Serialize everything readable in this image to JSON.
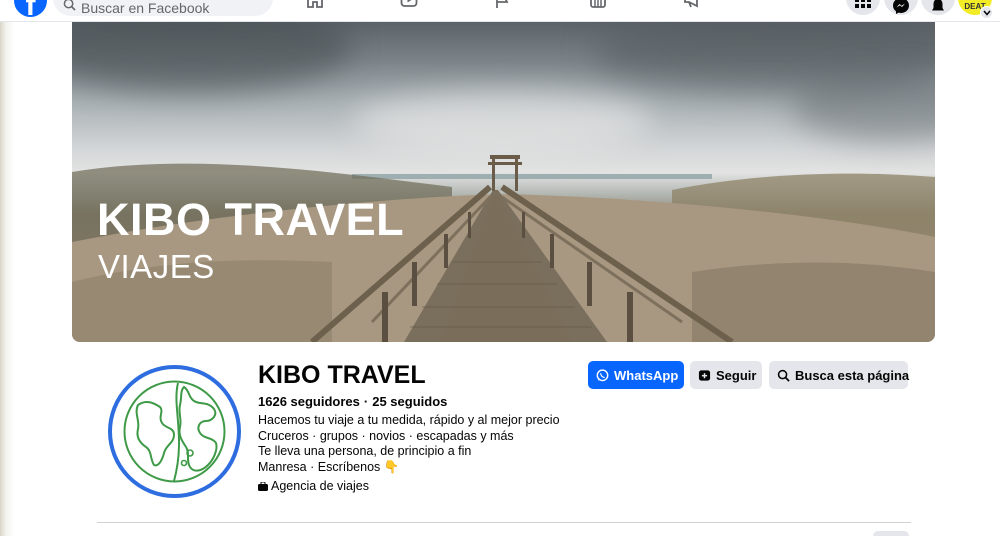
{
  "topbar": {
    "search_placeholder": "Buscar en Facebook",
    "logo": "facebook-logo",
    "nav_icons": [
      "home-icon",
      "video-icon",
      "flag-icon",
      "marketplace-icon",
      "megaphone-icon"
    ],
    "right_icons": [
      "grid-menu-icon",
      "messenger-icon",
      "bell-icon"
    ],
    "avatar_text": "DEAT"
  },
  "cover": {
    "title": "KIBO TRAVEL",
    "subtitle": "VIAJES"
  },
  "profile": {
    "name": "KIBO TRAVEL",
    "followers": "1626 seguidores",
    "separator": "·",
    "following": "25 seguidos",
    "bio": [
      "Hacemos tu viaje a tu medida, rápido y al mejor precio",
      "Cruceros · grupos · novios · escapadas y más",
      "Te lleva una persona, de principio a fin",
      "Manresa · Escríbenos 👇"
    ],
    "category": "Agencia de viajes"
  },
  "actions": {
    "whatsapp_label": "WhatsApp",
    "follow_label": "Seguir",
    "search_label": "Busca esta página"
  },
  "colors": {
    "accent": "#0866ff",
    "button_grey": "#e4e6eb",
    "logo_ring": "#2e6de0",
    "logo_globe": "#3e9a47"
  }
}
